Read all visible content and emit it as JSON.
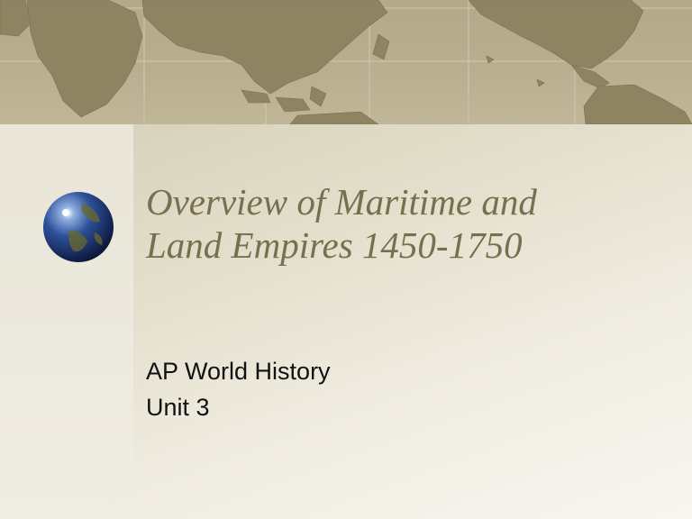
{
  "slide": {
    "title_lines": [
      "Overview of Maritime and",
      "Land Empires 1450-1750"
    ],
    "subtitle_lines": [
      "AP World History",
      "Unit 3"
    ]
  },
  "colors": {
    "title": "#76704e",
    "body_text": "#111111",
    "map_ocean": "#b9ae90",
    "map_land": "#8f8462",
    "map_grid": "#d8cfb2",
    "background": "#f3f0e6"
  },
  "icons": {
    "globe": "globe-icon",
    "world_map": "world-map-banner"
  }
}
